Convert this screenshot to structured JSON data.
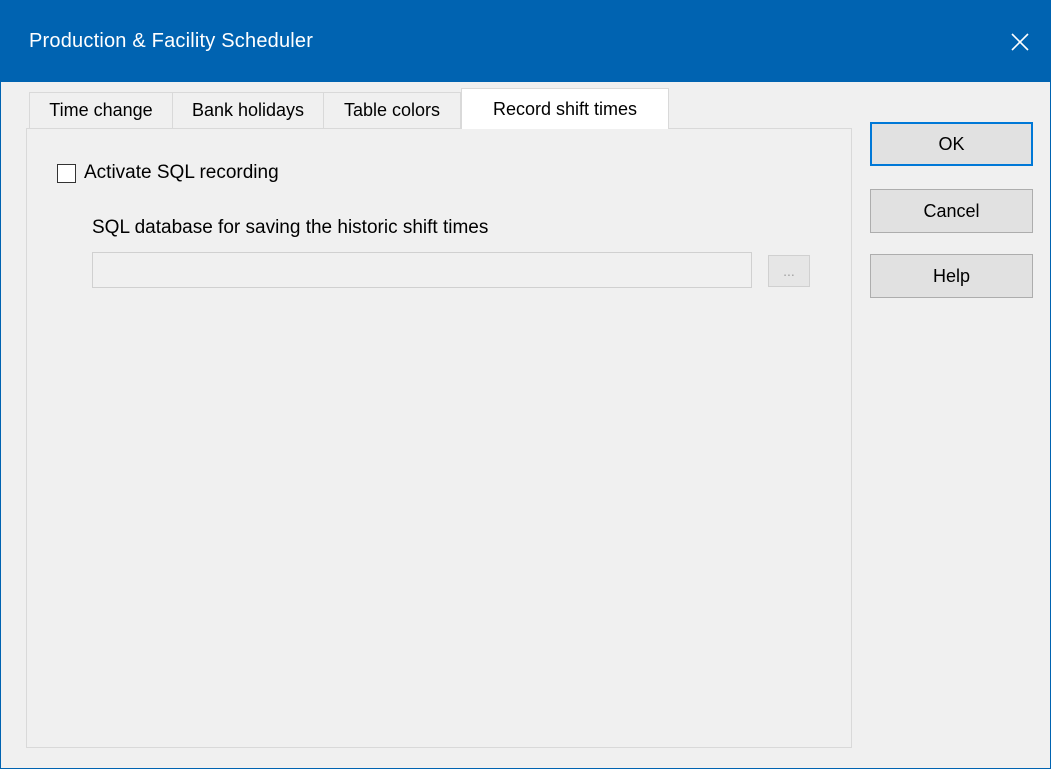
{
  "window": {
    "title": "Production & Facility Scheduler"
  },
  "tabs": [
    {
      "label": "Time change"
    },
    {
      "label": "Bank holidays"
    },
    {
      "label": "Table colors"
    },
    {
      "label": "Record shift times",
      "active": true
    }
  ],
  "record_shift_times": {
    "activate_sql_label": "Activate SQL recording",
    "activate_sql_checked": false,
    "database_group_label": "SQL database for saving the historic shift times",
    "database_value": "",
    "browse_label": "..."
  },
  "buttons": {
    "ok": "OK",
    "cancel": "Cancel",
    "help": "Help"
  },
  "colors": {
    "titlebar": "#0063b1",
    "default_button_border": "#0078d7"
  }
}
